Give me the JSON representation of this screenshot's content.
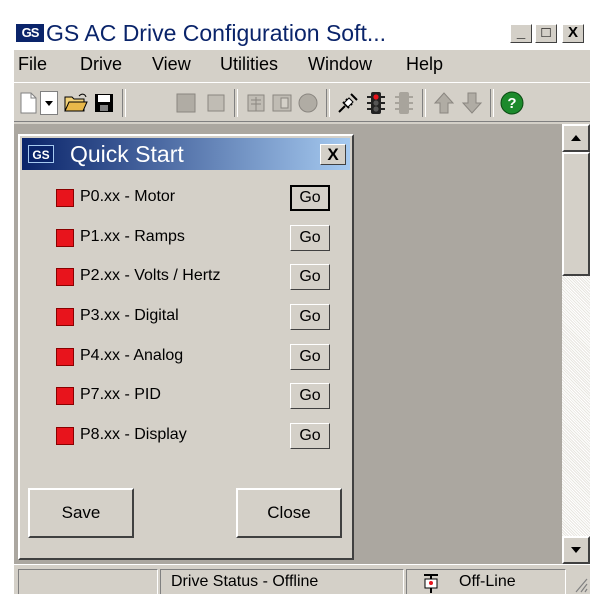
{
  "app": {
    "logo": "GS",
    "title": "GS AC Drive Configuration Soft...",
    "title_buttons": [
      "_",
      "□",
      "X"
    ]
  },
  "menu": [
    "File",
    "Drive",
    "View",
    "Utilities",
    "Window",
    "Help"
  ],
  "toolbar_icons": [
    "new-file-icon",
    "dropdown-arrow-icon",
    "open-folder-icon",
    "save-disk-icon",
    "stop-icon",
    "drive-icon",
    "parameters-icon",
    "record-icon",
    "connect-icon",
    "traffic-light-icon",
    "monitor-icon",
    "upload-arrow-icon",
    "download-arrow-icon",
    "help-icon"
  ],
  "quick_start": {
    "logo": "GS",
    "title": "Quick Start",
    "close": "X",
    "params": [
      {
        "label": "P0.xx - Motor",
        "go": "Go"
      },
      {
        "label": "P1.xx - Ramps",
        "go": "Go"
      },
      {
        "label": "P2.xx - Volts / Hertz",
        "go": "Go"
      },
      {
        "label": "P3.xx - Digital",
        "go": "Go"
      },
      {
        "label": "P4.xx - Analog",
        "go": "Go"
      },
      {
        "label": "P7.xx - PID",
        "go": "Go"
      },
      {
        "label": "P8.xx - Display",
        "go": "Go"
      }
    ],
    "save_label": "Save",
    "close_label": "Close"
  },
  "status": {
    "pane1": "",
    "drive_status": "Drive Status - Offline",
    "connection": "Off-Line"
  },
  "colors": {
    "title_blue": "#0a246a",
    "indicator_red": "#e8141c",
    "face": "#d4d0c8"
  }
}
